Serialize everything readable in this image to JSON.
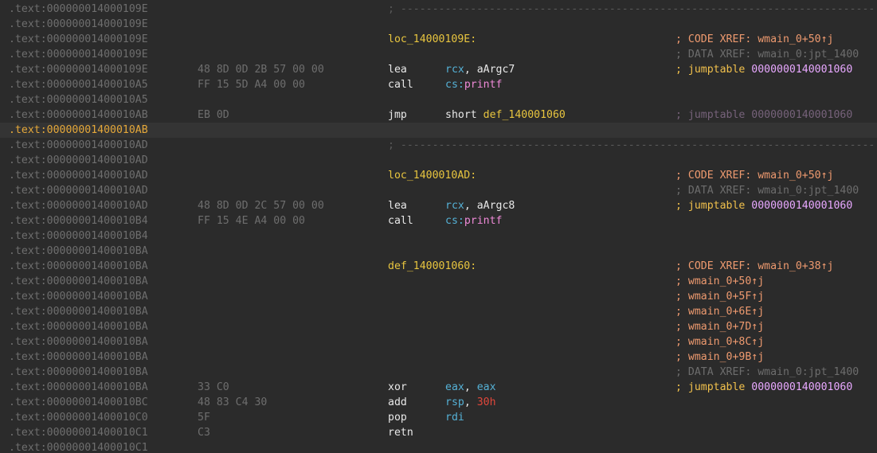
{
  "addresses": [
    ".text:000000014000109E",
    ".text:000000014000109E",
    ".text:000000014000109E",
    ".text:000000014000109E",
    ".text:000000014000109E",
    ".text:00000001400010A5",
    ".text:00000001400010A5",
    ".text:00000001400010AB",
    ".text:00000001400010AB",
    ".text:00000001400010AD",
    ".text:00000001400010AD",
    ".text:00000001400010AD",
    ".text:00000001400010AD",
    ".text:00000001400010AD",
    ".text:00000001400010B4",
    ".text:00000001400010B4",
    ".text:00000001400010BA",
    ".text:00000001400010BA",
    ".text:00000001400010BA",
    ".text:00000001400010BA",
    ".text:00000001400010BA",
    ".text:00000001400010BA",
    ".text:00000001400010BA",
    ".text:00000001400010BA",
    ".text:00000001400010BA",
    ".text:00000001400010BA",
    ".text:00000001400010BC",
    ".text:00000001400010C0",
    ".text:00000001400010C1",
    ".text:00000001400010C1"
  ],
  "bytes": {
    "r4": "48 8D 0D 2B 57 00 00",
    "r5": "FF 15 5D A4 00 00",
    "r7": "EB 0D",
    "r13": "48 8D 0D 2C 57 00 00",
    "r14": "FF 15 4E A4 00 00",
    "r25": "33 C0",
    "r26": "48 83 C4 30",
    "r27": "5F",
    "r28": "C3"
  },
  "separator": "; ---------------------------------------------------------------------------",
  "labels": {
    "loc1": "loc_14000109E:",
    "loc2": "loc_1400010AD:",
    "def": "def_140001060:"
  },
  "instructions": {
    "i1": {
      "mnemonic": "lea",
      "reg": "rcx",
      "sep": ", ",
      "sym": "aArgc7"
    },
    "i2": {
      "mnemonic": "call",
      "seg": "cs:",
      "fn": "printf"
    },
    "i3": {
      "mnemonic": "jmp",
      "kw": "short ",
      "target": "def_140001060"
    },
    "i4": {
      "mnemonic": "lea",
      "reg": "rcx",
      "sep": ", ",
      "sym": "aArgc8"
    },
    "i5": {
      "mnemonic": "call",
      "seg": "cs:",
      "fn": "printf"
    },
    "i6": {
      "mnemonic": "xor",
      "reg": "eax",
      "sep": ", ",
      "reg2": "eax"
    },
    "i7": {
      "mnemonic": "add",
      "reg": "rsp",
      "sep": ", ",
      "num": "30h"
    },
    "i8": {
      "mnemonic": "pop",
      "reg": "rdi"
    },
    "i9": {
      "mnemonic": "retn"
    }
  },
  "comments": {
    "codeXref": "; CODE XREF: ",
    "dataXref": "; DATA XREF: ",
    "jumptable": "; jumptable ",
    "semi": "; ",
    "ref_50": "wmain_0+50↑j",
    "ref_38": "wmain_0+38↑j",
    "ref_5F": "wmain_0+5F↑j",
    "ref_6E": "wmain_0+6E↑j",
    "ref_7D": "wmain_0+7D↑j",
    "ref_8C": "wmain_0+8C↑j",
    "ref_9B": "wmain_0+9B↑j",
    "jpt": "wmain_0:jpt_1400",
    "jt_addr": "0000000140001060"
  },
  "colors": {
    "background": "#2b2b2b",
    "current_line": "#343434",
    "address": "#6e6e6e",
    "current_address": "#e5a83a",
    "label": "#e8c53f",
    "register": "#55b1d6",
    "function": "#ef8ad8",
    "number": "#e0473b",
    "xref": "#ee9a6f",
    "comment_accent": "#e8a8ff"
  }
}
